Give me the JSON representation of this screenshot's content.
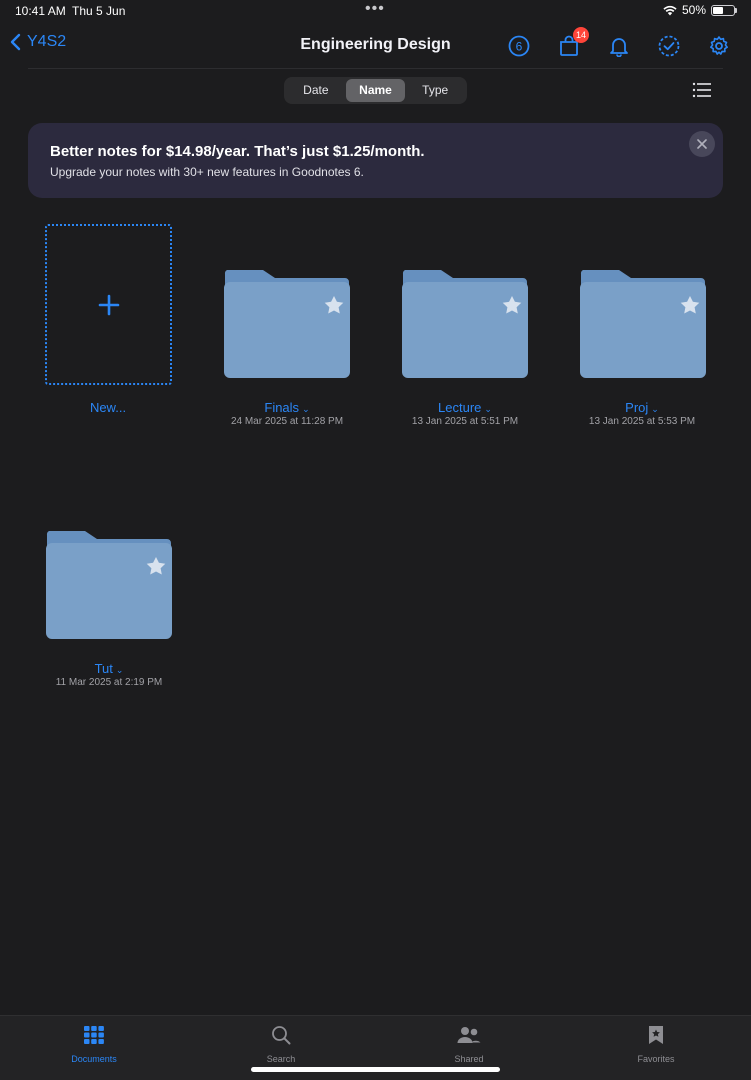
{
  "status_bar": {
    "time": "10:41 AM",
    "date": "Thu 5 Jun",
    "dots": "•••",
    "battery_percent": "50%",
    "battery_level": 0.5
  },
  "nav": {
    "back_label": "Y4S2",
    "title": "Engineering Design",
    "badge_count": "14",
    "icons": [
      "timer-6-icon",
      "shopping-bag-icon",
      "bell-icon",
      "select-check-icon",
      "gear-icon"
    ]
  },
  "sort": {
    "options": [
      "Date",
      "Name",
      "Type"
    ],
    "selected": "Name"
  },
  "banner": {
    "title": "Better notes for $14.98/year. That’s just $1.25/month.",
    "subtitle": "Upgrade your notes with 30+ new features in Goodnotes 6."
  },
  "new_item": {
    "label": "New..."
  },
  "folders": [
    {
      "name": "Finals",
      "date": "24 Mar 2025 at 11:28 PM"
    },
    {
      "name": "Lecture",
      "date": "13 Jan 2025 at 5:51 PM"
    },
    {
      "name": "Proj",
      "date": "13 Jan 2025 at 5:53 PM"
    },
    {
      "name": "Tut",
      "date": "11 Mar 2025 at 2:19 PM"
    }
  ],
  "tabs": [
    {
      "label": "Documents",
      "icon": "grid-icon",
      "active": true
    },
    {
      "label": "Search",
      "icon": "search-icon",
      "active": false
    },
    {
      "label": "Shared",
      "icon": "people-icon",
      "active": false
    },
    {
      "label": "Favorites",
      "icon": "bookmark-star-icon",
      "active": false
    }
  ],
  "colors": {
    "accent": "#2b86f5",
    "folder": "#7aa0c8",
    "folder_tab": "#6690bf",
    "badge": "#ff453a",
    "background": "#1c1c1e"
  }
}
